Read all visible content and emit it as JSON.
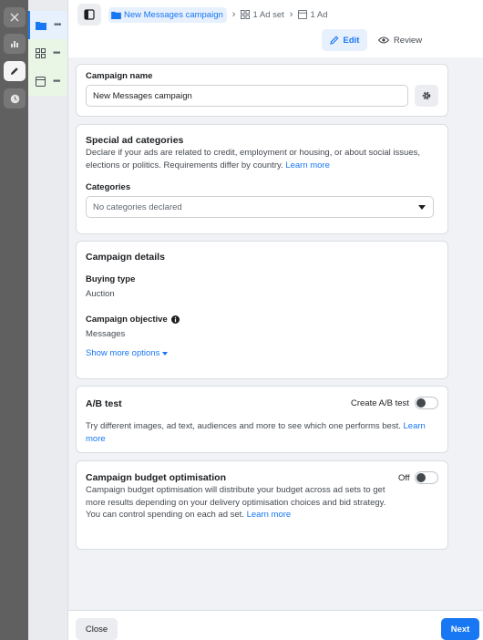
{
  "header": {
    "breadcrumbs": [
      "New Messages campaign",
      "1 Ad set",
      "1 Ad"
    ],
    "modes": {
      "edit": "Edit",
      "review": "Review"
    }
  },
  "campaign_name": {
    "label": "Campaign name",
    "value": "New Messages campaign"
  },
  "special_ad": {
    "title": "Special ad categories",
    "description": "Declare if your ads are related to credit, employment or housing, or about social issues, elections or politics. Requirements differ by country.",
    "link": "Learn more",
    "categories_label": "Categories",
    "categories_placeholder": "No categories declared"
  },
  "campaign_details": {
    "title": "Campaign details",
    "buying_type_label": "Buying type",
    "buying_type_value": "Auction",
    "objective_label": "Campaign objective",
    "objective_value": "Messages",
    "more_options": "Show more options"
  },
  "ab_test": {
    "title": "A/B test",
    "toggle_label": "Create A/B test",
    "toggle_on": false,
    "description": "Try different images, ad text, audiences and more to see which one performs best.",
    "link": "Learn more"
  },
  "budget": {
    "title": "Campaign budget optimisation",
    "toggle_label": "Off",
    "toggle_on": false,
    "description": "Campaign budget optimisation will distribute your budget across ad sets to get more results depending on your delivery optimisation choices and bid strategy. You can control spending on each ad set.",
    "link": "Learn more"
  },
  "footer": {
    "close": "Close",
    "next": "Next"
  },
  "colors": {
    "accent": "#1877f2",
    "rail": "#606060"
  }
}
